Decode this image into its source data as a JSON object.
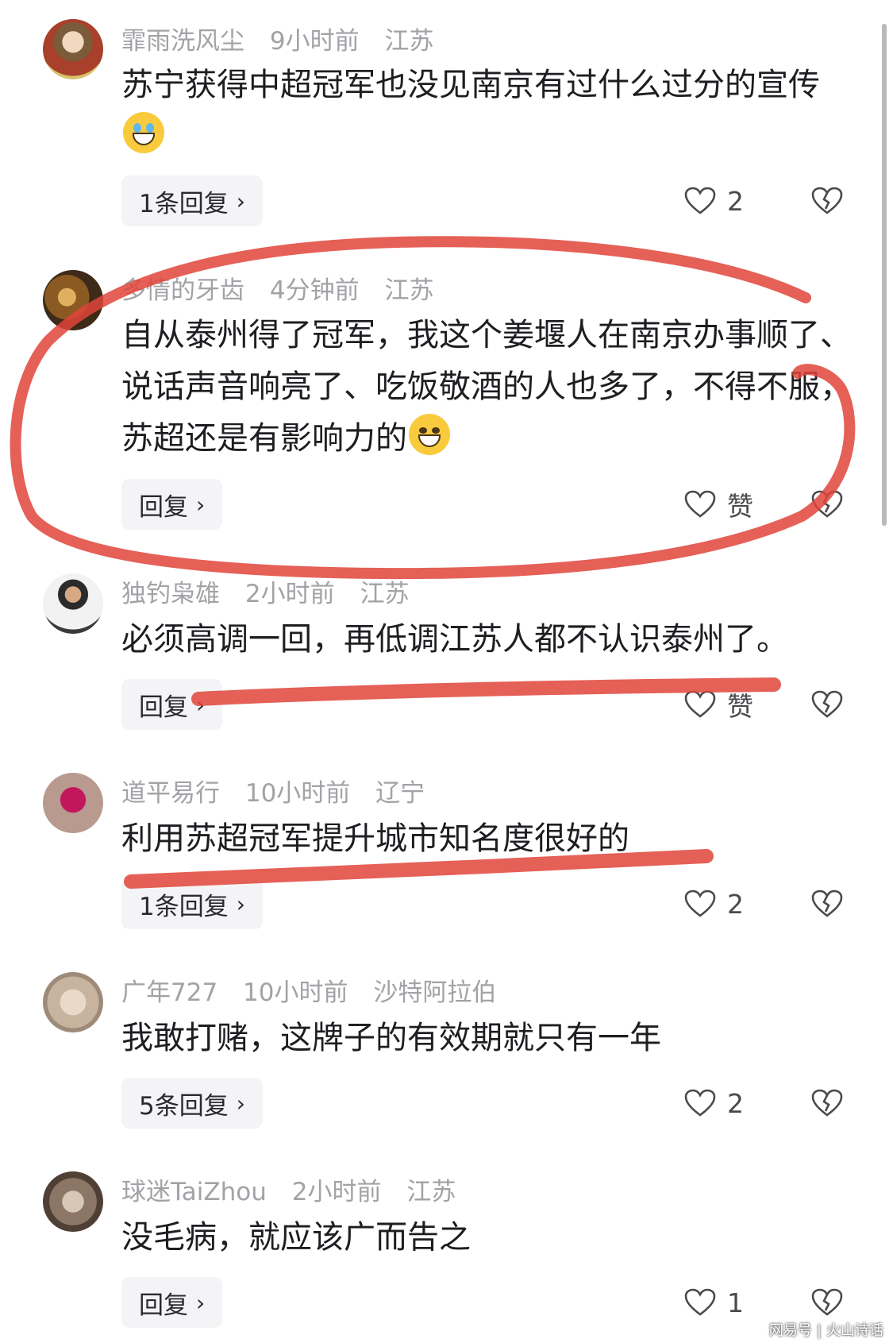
{
  "comments": [
    {
      "username": "霏雨洗风尘",
      "time": "9小时前",
      "location": "江苏",
      "text": "苏宁获得中超冠军也没见南京有过什么过分的宣传",
      "emoji": "crying-laughing-emoji",
      "reply_label": "1条回复",
      "like_count": "2"
    },
    {
      "username": "多情的牙齿",
      "time": "4分钟前",
      "location": "江苏",
      "text": "自从泰州得了冠军，我这个姜堰人在南京办事顺了、说话声音响亮了、吃饭敬酒的人也多了，不得不服，苏超还是有影响力的",
      "emoji": "grinning-emoji",
      "reply_label": "回复",
      "like_count": "赞"
    },
    {
      "username": "独钓枭雄",
      "time": "2小时前",
      "location": "江苏",
      "text": "必须高调一回，再低调江苏人都不认识泰州了。",
      "reply_label": "回复",
      "like_count": "赞"
    },
    {
      "username": "道平易行",
      "time": "10小时前",
      "location": "辽宁",
      "text": "利用苏超冠军提升城市知名度很好的",
      "reply_label": "1条回复",
      "like_count": "2"
    },
    {
      "username": "广年727",
      "time": "10小时前",
      "location": "沙特阿拉伯",
      "text": "我敢打赌，这牌子的有效期就只有一年",
      "reply_label": "5条回复",
      "like_count": "2"
    },
    {
      "username": "球迷TaiZhou",
      "time": "2小时前",
      "location": "江苏",
      "text": "没毛病，就应该广而告之",
      "reply_label": "回复",
      "like_count": "1"
    }
  ],
  "watermark": {
    "source": "网易号",
    "author": "火山诗话"
  },
  "icons": {
    "like": "heart-icon",
    "dislike": "broken-heart-icon",
    "chevron": "chevron-right-icon"
  },
  "colors": {
    "annotation_red": "#e0443a",
    "meta_gray": "#a2a2a7",
    "button_bg": "#f4f4f6"
  }
}
